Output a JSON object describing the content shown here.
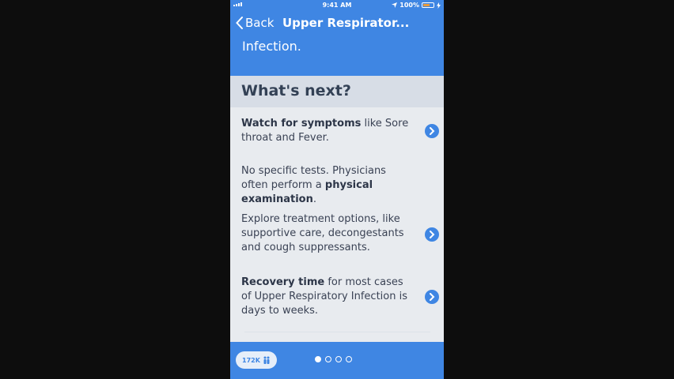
{
  "status_bar": {
    "time": "9:41 AM",
    "battery": "100%"
  },
  "nav": {
    "back_label": "Back",
    "title": "Upper Respirator..."
  },
  "header": {
    "subtitle": "Infection."
  },
  "section": {
    "title": "What's next?"
  },
  "items": [
    {
      "bold": "Watch for symptoms",
      "text": " like Sore throat and Fever.",
      "has_link": true
    },
    {
      "text": "No specific tests. Physicians often perform a ",
      "bold": "physical examination",
      "suffix": ".",
      "has_link": false
    },
    {
      "text": "Explore treatment options, like supportive care, decongestants and cough suppressants.",
      "has_link": true
    },
    {
      "bold": "Recovery time",
      "text": " for most cases of Upper Respiratory Infection is days to weeks.",
      "has_link": true
    }
  ],
  "footer": {
    "count": "172K",
    "pages": 4,
    "active_page": 1
  },
  "colors": {
    "accent": "#3f86e3",
    "header_bg": "#3f86e3",
    "section_bg": "#d7dde6",
    "body_bg": "#e8ebef"
  }
}
